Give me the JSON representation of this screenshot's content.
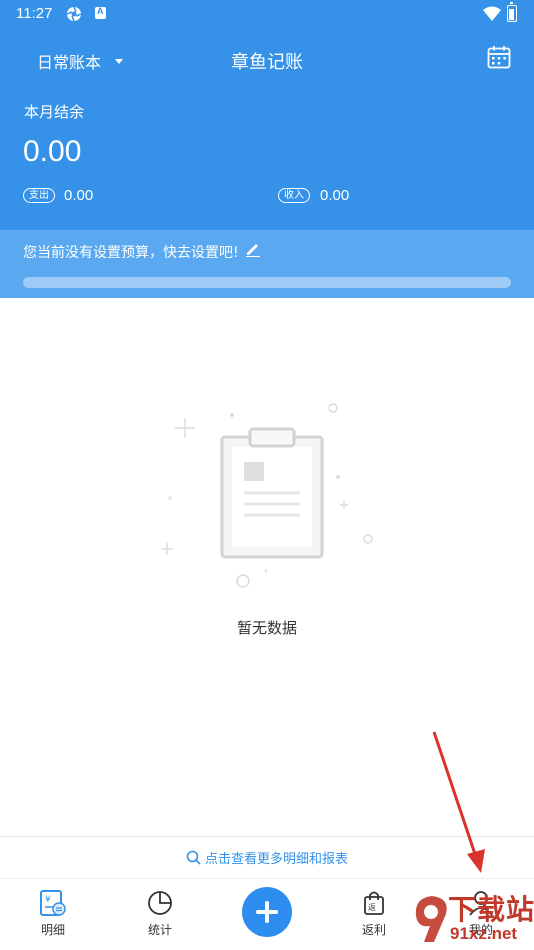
{
  "status_bar": {
    "time": "11:27"
  },
  "header": {
    "book_name": "日常账本",
    "app_title": "章鱼记账",
    "balance_label": "本月结余",
    "balance_value": "0.00",
    "expense_label": "支出",
    "expense_value": "0.00",
    "income_label": "收入",
    "income_value": "0.00"
  },
  "budget": {
    "prompt": "您当前没有设置预算，快去设置吧!",
    "progress": 0
  },
  "empty_state": {
    "text": "暂无数据"
  },
  "more_link": {
    "label": "点击查看更多明细和报表"
  },
  "tabbar": {
    "tabs": [
      {
        "label": "明细",
        "icon": "ledger-icon"
      },
      {
        "label": "统计",
        "icon": "pie-chart-icon"
      },
      {
        "label": "",
        "icon": "add-icon"
      },
      {
        "label": "返利",
        "icon": "shopping-bag-icon"
      },
      {
        "label": "我的",
        "icon": "person-icon"
      }
    ]
  },
  "watermark": {
    "big": "下载站",
    "small": "91xz.net"
  },
  "colors": {
    "primary": "#3592e8",
    "budget_band": "#5aa9f0",
    "fab": "#2e8ef0",
    "annotation_arrow": "#d9342b"
  }
}
